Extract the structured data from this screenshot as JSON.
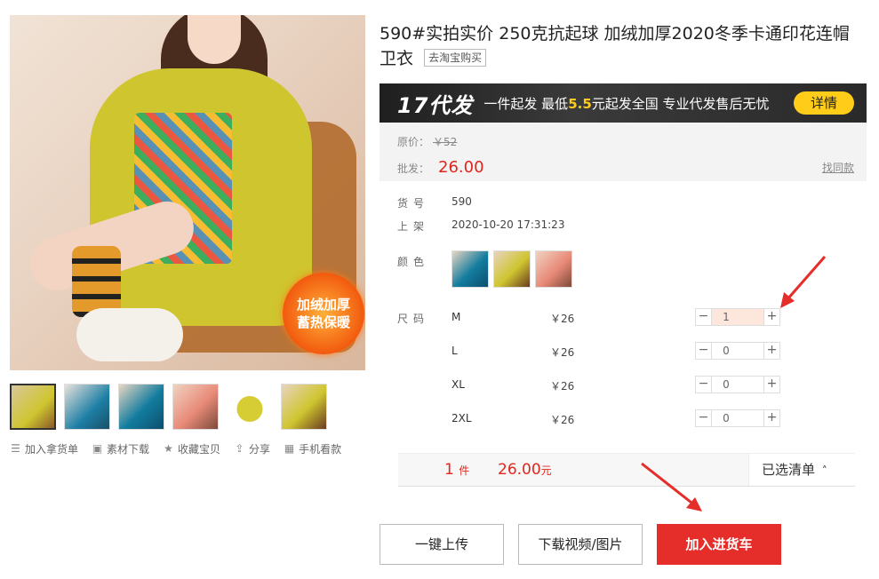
{
  "gallery": {
    "badge_line1": "加绒加厚",
    "badge_line2": "蓄热保暖",
    "thumbnails": [
      "yellow-front",
      "blue",
      "teal",
      "pink",
      "yellow-flat",
      "yellow-side"
    ]
  },
  "actions": [
    {
      "icon": "list-icon",
      "label": "加入拿货单"
    },
    {
      "icon": "image-download-icon",
      "label": "素材下载"
    },
    {
      "icon": "star-icon",
      "label": "收藏宝贝"
    },
    {
      "icon": "share-icon",
      "label": "分享"
    },
    {
      "icon": "qr-code-icon",
      "label": "手机看款"
    }
  ],
  "product": {
    "title": "590#实拍实价 250克抗起球 加绒加厚2020冬季卡通印花连帽卫衣",
    "taobao_link": "去淘宝购买"
  },
  "promo": {
    "big": "17代发",
    "text_pre": "一件起发 最低",
    "highlight": "5.5",
    "text_post": "元起发全国 专业代发售后无忧",
    "detail_label": "详情"
  },
  "price": {
    "original_label": "原价：",
    "original_value": "￥52",
    "wholesale_label": "批发：",
    "wholesale_value": "26.00",
    "find_same": "找同款"
  },
  "specs": {
    "sku_label": "货号",
    "sku_value": "590",
    "listed_label": "上架",
    "listed_value": "2020-10-20 17:31:23",
    "color_label": "颜色",
    "size_label": "尺码"
  },
  "colors": [
    "teal",
    "yellow",
    "pink"
  ],
  "sizes": [
    {
      "name": "M",
      "price": "￥26",
      "qty": "1"
    },
    {
      "name": "L",
      "price": "￥26",
      "qty": "0"
    },
    {
      "name": "XL",
      "price": "￥26",
      "qty": "0"
    },
    {
      "name": "2XL",
      "price": "￥26",
      "qty": "0"
    }
  ],
  "stepper": {
    "minus": "−",
    "plus": "+"
  },
  "summary": {
    "count": "1",
    "count_unit": "件",
    "amount": "26.00",
    "amount_unit": "元",
    "selected_list": "已选清单",
    "caret": "˄"
  },
  "buttons": {
    "upload": "一键上传",
    "download": "下载视频/图片",
    "add_cart": "加入进货车"
  },
  "colors_theme": {
    "accent_red": "#e1251b",
    "button_red": "#e52d2a",
    "promo_yellow": "#ffcc1a"
  }
}
